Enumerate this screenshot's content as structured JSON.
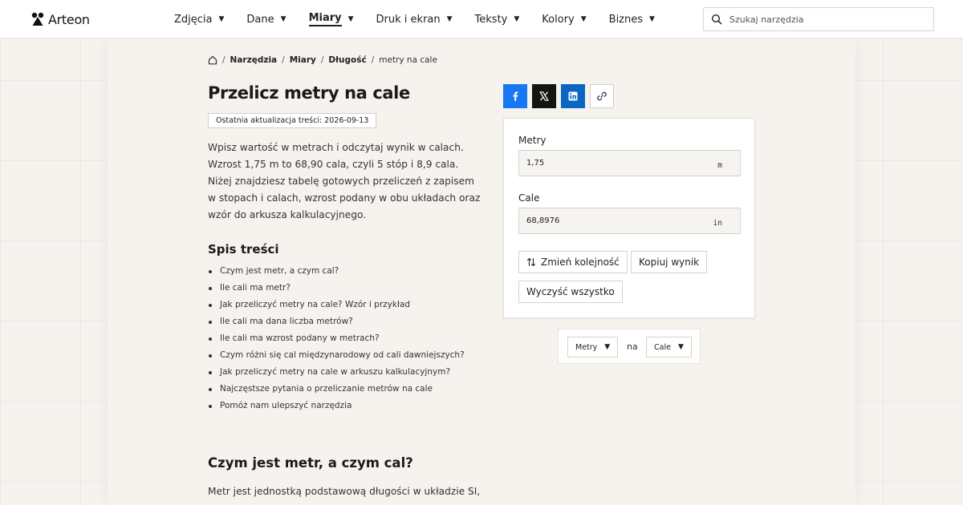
{
  "header": {
    "brand": "Arteon",
    "nav": [
      {
        "label": "Zdjęcia",
        "active": false
      },
      {
        "label": "Dane",
        "active": false
      },
      {
        "label": "Miary",
        "active": true
      },
      {
        "label": "Druk i ekran",
        "active": false
      },
      {
        "label": "Teksty",
        "active": false
      },
      {
        "label": "Kolory",
        "active": false
      },
      {
        "label": "Biznes",
        "active": false
      }
    ],
    "search_placeholder": "Szukaj narzędzia"
  },
  "breadcrumb": {
    "items": [
      "Narzędzia",
      "Miary",
      "Długość"
    ],
    "current": "metry na cale"
  },
  "article": {
    "title": "Przelicz metry na cale",
    "updated": "Ostatnia aktualizacja treści: 2026-09-13",
    "intro": "Wpisz wartość w metrach i odczytaj wynik w calach. Wzrost 1,75 m to 68,90 cala, czyli 5 stóp i 8,9 cala. Niżej znajdziesz tabelę gotowych przeliczeń z zapisem w stopach i calach, wzrost podany w obu układach oraz wzór do arkusza kalkulacyjnego.",
    "toc_title": "Spis treści",
    "toc": [
      "Czym jest metr, a czym cal?",
      "Ile cali ma metr?",
      "Jak przeliczyć metry na cale? Wzór i przykład",
      "Ile cali ma dana liczba metrów?",
      "Ile cali ma wzrost podany w metrach?",
      "Czym różni się cal międzynarodowy od cali dawniejszych?",
      "Jak przeliczyć metry na cale w arkuszu kalkulacyjnym?",
      "Najczęstsze pytania o przeliczanie metrów na cale",
      "Pomóż nam ulepszyć narzędzia"
    ],
    "section_heading": "Czym jest metr, a czym cal?",
    "section_para": "Metr jest jednostką podstawową długości w układzie SI,"
  },
  "share": {
    "icons": [
      "facebook-icon",
      "x-icon",
      "linkedin-icon",
      "link-icon"
    ],
    "colors": {
      "facebook": "#1877f2",
      "x": "#141414",
      "linkedin": "#0a66c2"
    }
  },
  "converter": {
    "from_label": "Metry",
    "from_value": "1,75",
    "from_unit": "m",
    "to_label": "Cale",
    "to_value": "68,8976",
    "to_unit": "in",
    "swap_label": "Zmień kolejność",
    "copy_label": "Kopiuj wynik",
    "clear_label": "Wyczyść wszystko"
  },
  "unit_picker": {
    "from": "Metry",
    "connector": "na",
    "to": "Cale"
  }
}
